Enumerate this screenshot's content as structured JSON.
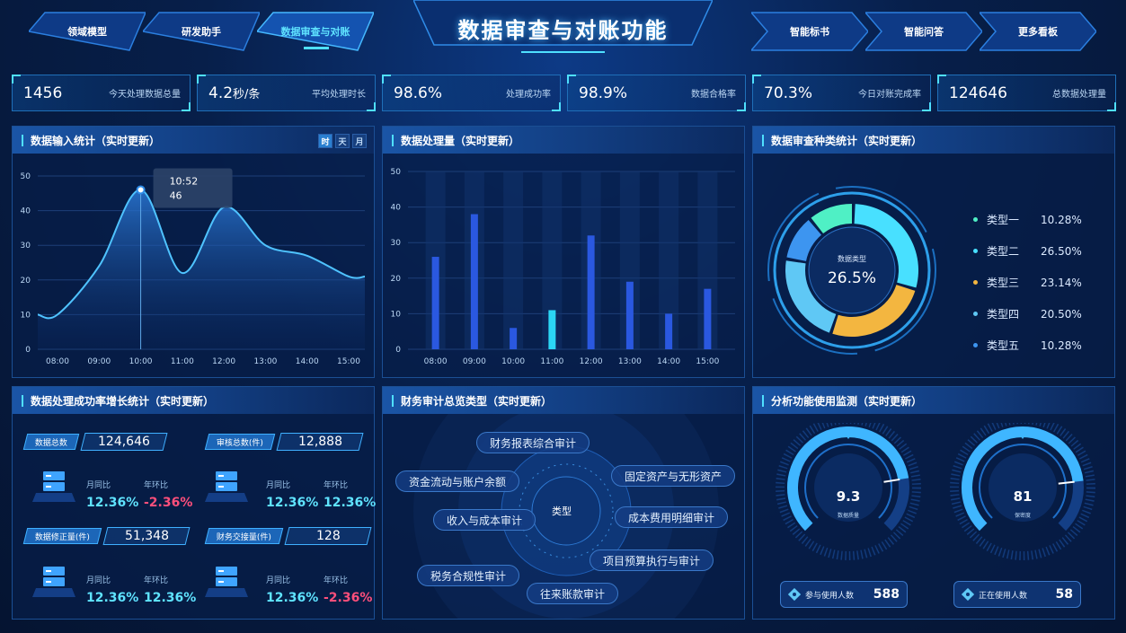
{
  "header": {
    "title": "数据审查与对账功能",
    "nav_left": [
      "领域模型",
      "研发助手",
      "数据审查与对账"
    ],
    "nav_right": [
      "智能标书",
      "智能问答",
      "更多看板"
    ]
  },
  "kpis": [
    {
      "value": "1456",
      "unit": "",
      "label": "今天处理数据总量"
    },
    {
      "value": "4.2",
      "unit": "秒/条",
      "label": "平均处理时长"
    },
    {
      "value": "98.6%",
      "unit": "",
      "label": "处理成功率"
    },
    {
      "value": "98.9%",
      "unit": "",
      "label": "数据合格率"
    },
    {
      "value": "70.3%",
      "unit": "",
      "label": "今日对账完成率"
    },
    {
      "value": "124646",
      "unit": "",
      "label": "总数据处理量"
    }
  ],
  "panel_input": {
    "title": "数据输入统计（实时更新）",
    "toggles": [
      "时",
      "天",
      "月"
    ],
    "tooltip": {
      "time": "10:52",
      "value": "46"
    }
  },
  "panel_volume": {
    "title": "数据处理量（实时更新）"
  },
  "panel_types": {
    "title": "数据审查种类统计（实时更新）",
    "center_label": "数据类型",
    "center_value": "26.5%",
    "legend": [
      {
        "name": "类型一",
        "value": "10.28%",
        "color": "#4ff0c5"
      },
      {
        "name": "类型二",
        "value": "26.50%",
        "color": "#48e0ff"
      },
      {
        "name": "类型三",
        "value": "23.14%",
        "color": "#f3b640"
      },
      {
        "name": "类型四",
        "value": "20.50%",
        "color": "#5fc8f5"
      },
      {
        "name": "类型五",
        "value": "10.28%",
        "color": "#3d95f0"
      }
    ]
  },
  "panel_success": {
    "title": "数据处理成功率增长统计（实时更新）",
    "cards": [
      {
        "tag": "数据总数",
        "value": "124,646",
        "mom_label": "月同比",
        "mom": "12.36%",
        "yoy_label": "年环比",
        "yoy": "-2.36%"
      },
      {
        "tag": "审核总数(件)",
        "value": "12,888",
        "mom_label": "月同比",
        "mom": "12.36%",
        "yoy_label": "年环比",
        "yoy": "12.36%"
      },
      {
        "tag": "数据修正量(件)",
        "value": "51,348",
        "mom_label": "月同比",
        "mom": "12.36%",
        "yoy_label": "年环比",
        "yoy": "12.36%"
      },
      {
        "tag": "财务交接量(件)",
        "value": "128",
        "mom_label": "月同比",
        "mom": "12.36%",
        "yoy_label": "年环比",
        "yoy": "-2.36%"
      }
    ]
  },
  "panel_audit": {
    "title": "财务审计总览类型（实时更新）",
    "center": "类型",
    "items": [
      "财务报表综合审计",
      "资金流动与账户余额",
      "固定资产与无形资产",
      "收入与成本审计",
      "成本费用明细审计",
      "项目预算执行与审计",
      "税务合规性审计",
      "往来账款审计"
    ]
  },
  "panel_usage": {
    "title": "分析功能使用监测（实时更新）",
    "gauges": [
      {
        "value": "9.3",
        "label": "数据质量",
        "fraction": 0.8
      },
      {
        "value": "81",
        "label": "保密度",
        "fraction": 0.81
      }
    ],
    "counters": [
      {
        "label": "参与使用人数",
        "value": "588"
      },
      {
        "label": "正在使用人数",
        "value": "58"
      }
    ]
  },
  "chart_data": [
    {
      "type": "area",
      "x": [
        "08:00",
        "09:00",
        "10:00",
        "11:00",
        "12:00",
        "13:00",
        "14:00",
        "15:00"
      ],
      "y": [
        10,
        24,
        46,
        22,
        41,
        30,
        27,
        21
      ],
      "ylim": [
        0,
        50
      ],
      "yticks": [
        0,
        10,
        20,
        30,
        40,
        50
      ]
    },
    {
      "type": "bar",
      "categories": [
        "08:00",
        "09:00",
        "10:00",
        "11:00",
        "12:00",
        "13:00",
        "14:00",
        "15:00"
      ],
      "values": [
        26,
        38,
        6,
        11,
        32,
        19,
        10,
        17
      ],
      "highlight": [
        false,
        false,
        false,
        true,
        false,
        false,
        false,
        false
      ],
      "ylim": [
        0,
        50
      ],
      "yticks": [
        0,
        10,
        20,
        30,
        40,
        50
      ]
    },
    {
      "type": "pie",
      "labels": [
        "类型一",
        "类型二",
        "类型三",
        "类型四",
        "类型五"
      ],
      "values": [
        10.28,
        26.5,
        23.14,
        20.5,
        10.28
      ]
    }
  ]
}
